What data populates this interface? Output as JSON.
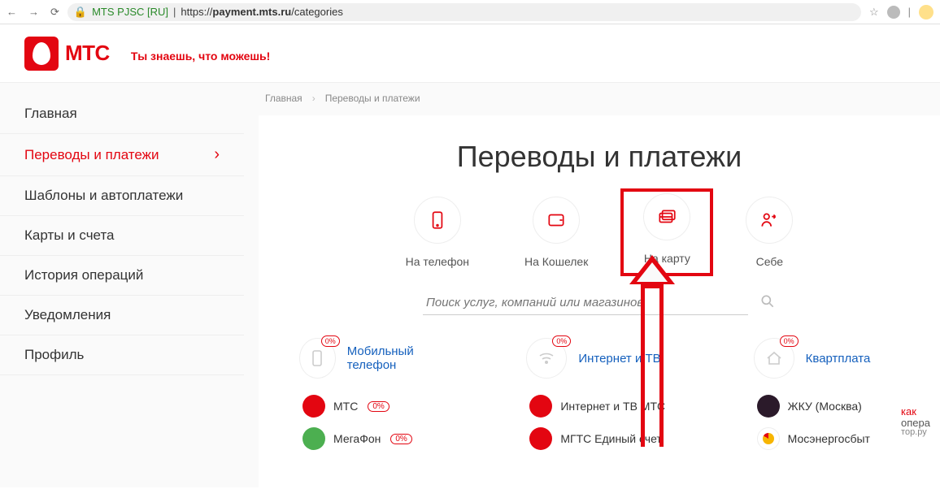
{
  "browser": {
    "org": "MTS PJSC [RU]",
    "url_host": "payment.mts.ru",
    "url_path": "/categories",
    "url_prefix": "https://"
  },
  "header": {
    "brand": "МТС",
    "slogan": "Ты знаешь, что можешь!"
  },
  "sidebar": {
    "items": [
      {
        "label": "Главная",
        "active": false
      },
      {
        "label": "Переводы и платежи",
        "active": true
      },
      {
        "label": "Шаблоны и автоплатежи",
        "active": false
      },
      {
        "label": "Карты и счета",
        "active": false
      },
      {
        "label": "История операций",
        "active": false
      },
      {
        "label": "Уведомления",
        "active": false
      },
      {
        "label": "Профиль",
        "active": false
      }
    ]
  },
  "breadcrumb": {
    "root": "Главная",
    "current": "Переводы и платежи"
  },
  "main": {
    "title": "Переводы и платежи",
    "tiles": [
      {
        "label": "На телефон",
        "icon": "phone-outline-icon"
      },
      {
        "label": "На Кошелек",
        "icon": "wallet-icon"
      },
      {
        "label": "На карту",
        "icon": "cards-icon",
        "highlight": true
      },
      {
        "label": "Себе",
        "icon": "self-transfer-icon"
      }
    ],
    "search_placeholder": "Поиск услуг, компаний или магазинов",
    "categories": [
      {
        "title": "Мобильный телефон",
        "icon": "mobile-icon",
        "badge": "0%",
        "items": [
          {
            "label": "МТС",
            "badge": "0%",
            "icon": "mts"
          },
          {
            "label": "МегаФон",
            "badge": "0%",
            "icon": "green"
          }
        ]
      },
      {
        "title": "Интернет и ТВ",
        "icon": "wifi-icon",
        "badge": "0%",
        "items": [
          {
            "label": "Интернет и ТВ МТС",
            "icon": "mts"
          },
          {
            "label": "МГТС Единый счет",
            "icon": "mts"
          }
        ]
      },
      {
        "title": "Квартплата",
        "icon": "house-icon",
        "badge": "0%",
        "items": [
          {
            "label": "ЖКУ (Москва)",
            "icon": "dark"
          },
          {
            "label": "Мосэнергосбыт",
            "icon": "yellow"
          }
        ]
      }
    ]
  },
  "watermark": {
    "l1": "как",
    "l2": "опера",
    "l3": "тор.ру"
  },
  "colors": {
    "accent": "#e30611",
    "link": "#1560bd"
  }
}
